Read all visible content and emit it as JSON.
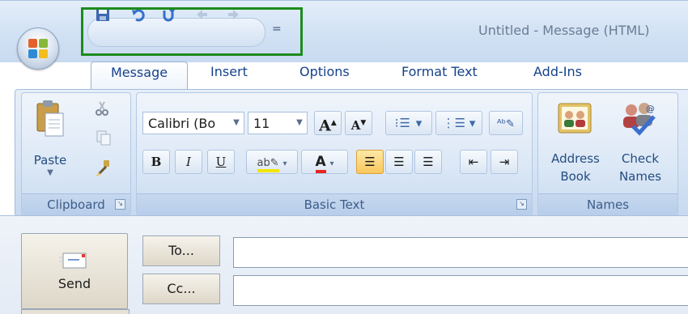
{
  "window": {
    "title": "Untitled - Message (HTML)"
  },
  "quick_access": {
    "icons": [
      "save-icon",
      "undo-icon",
      "redo-icon",
      "previous-item-icon",
      "next-item-icon"
    ],
    "customize": "="
  },
  "tabs": [
    {
      "label": "Message",
      "active": true
    },
    {
      "label": "Insert",
      "active": false
    },
    {
      "label": "Options",
      "active": false
    },
    {
      "label": "Format Text",
      "active": false
    },
    {
      "label": "Add-Ins",
      "active": false
    }
  ],
  "ribbon": {
    "clipboard": {
      "label": "Clipboard",
      "paste": "Paste"
    },
    "basic_text": {
      "label": "Basic Text",
      "font_name": "Calibri (Bo",
      "font_size": "11",
      "bold": "B",
      "italic": "I",
      "underline": "U",
      "grow": "A",
      "shrink": "A"
    },
    "names": {
      "label": "Names",
      "address_book_line1": "Address",
      "address_book_line2": "Book",
      "check_names_line1": "Check",
      "check_names_line2": "Names"
    }
  },
  "compose": {
    "send": "Send",
    "to": "To...",
    "cc": "Cc...",
    "to_value": "",
    "cc_value": ""
  },
  "colors": {
    "highlight_frame": "#1c8b1c",
    "tab_text": "#15428b",
    "highlight_color": "#f2e600",
    "font_color": "#e8261d"
  }
}
